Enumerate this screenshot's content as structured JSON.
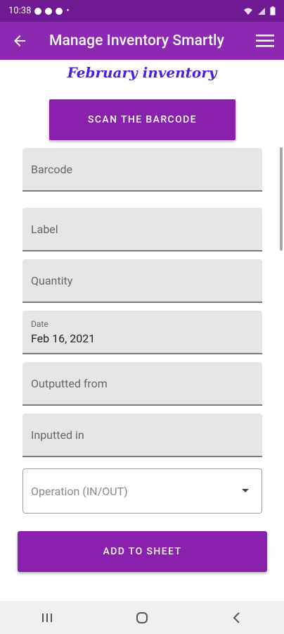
{
  "status_bar": {
    "time": "10:38",
    "dot": "•",
    "icons": [
      "notification-icon",
      "notification-icon",
      "notification-icon",
      "wifi-icon",
      "signal-icon",
      "battery-icon"
    ]
  },
  "app_bar": {
    "title": "Manage Inventory Smartly",
    "back_icon": "back-arrow-icon",
    "menu_icon": "hamburger-menu-icon",
    "color": "#8c28b2"
  },
  "page": {
    "heading": "February inventory",
    "scan_button": "SCAN THE BARCODE",
    "fields": {
      "barcode": {
        "placeholder": "Barcode"
      },
      "label": {
        "placeholder": "Label"
      },
      "quantity": {
        "placeholder": "Quantity"
      },
      "date": {
        "label": "Date",
        "value": "Feb 16, 2021"
      },
      "outputted_from": {
        "placeholder": "Outputted from"
      },
      "inputted_in": {
        "placeholder": "Inputted in"
      }
    },
    "operation_dropdown": {
      "placeholder": "Operation (IN/OUT)"
    },
    "add_button": "ADD TO SHEET",
    "accent_color": "#8a21ae"
  },
  "nav_bar": {
    "buttons": [
      "recent-apps-icon",
      "home-icon",
      "back-icon"
    ]
  }
}
